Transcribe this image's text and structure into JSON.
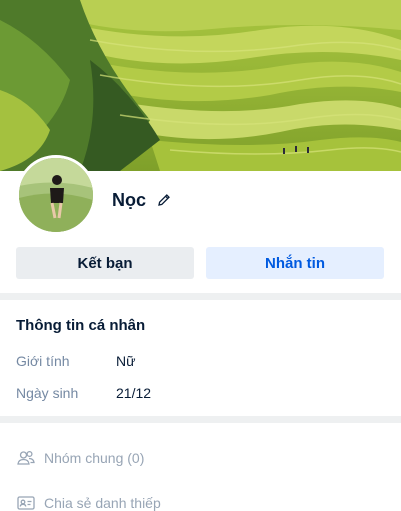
{
  "profile": {
    "name": "Nọc"
  },
  "actions": {
    "add_friend_label": "Kết bạn",
    "message_label": "Nhắn tin"
  },
  "personal_info": {
    "title": "Thông tin cá nhân",
    "rows": [
      {
        "label": "Giới tính",
        "value": "Nữ"
      },
      {
        "label": "Ngày sinh",
        "value": "21/12"
      }
    ]
  },
  "menu": {
    "common_groups_label": "Nhóm chung (0)",
    "share_card_label": "Chia sẻ danh thiếp"
  },
  "icons": {
    "edit": "pencil-icon",
    "groups": "people-icon",
    "card": "contact-card-icon"
  },
  "colors": {
    "accent": "#005ae0",
    "accent_bg": "#e5efff",
    "muted": "#98a5b5"
  }
}
